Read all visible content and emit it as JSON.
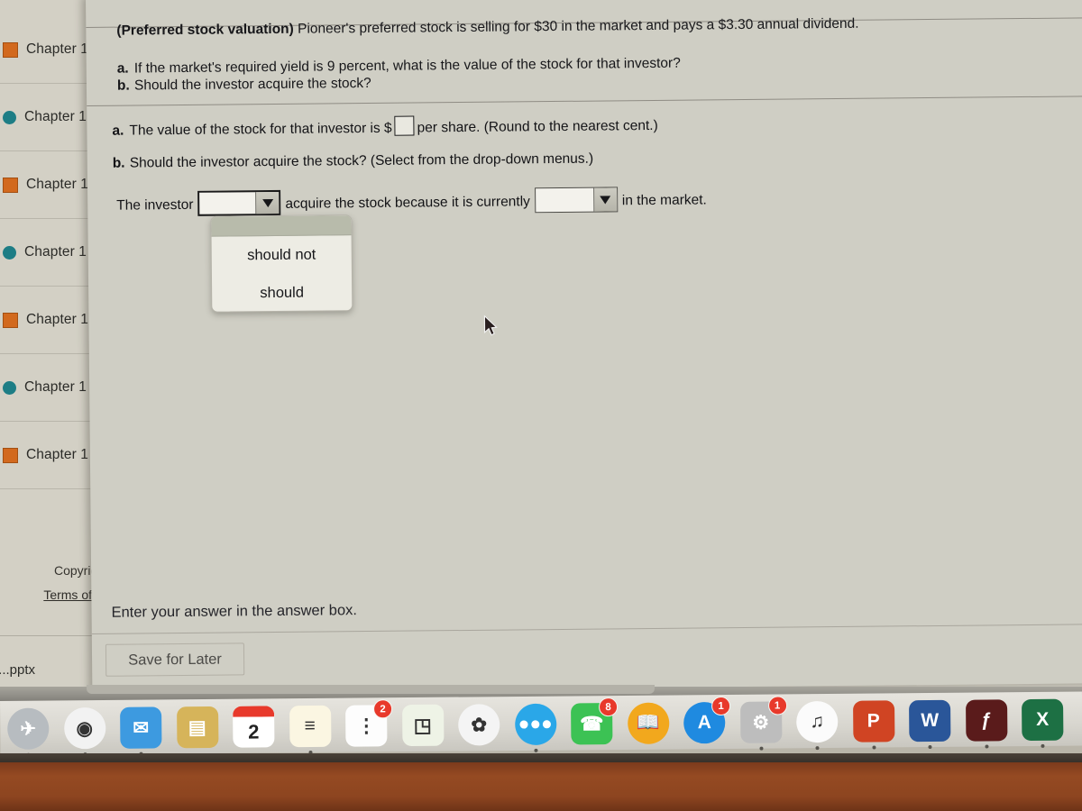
{
  "question": {
    "topic_label": "(Preferred stock valuation)",
    "stem": "Pioneer's preferred stock is selling for $30 in the market and pays a $3.30 annual dividend.",
    "parts": [
      {
        "letter": "a.",
        "text": "If the market's required yield is 9 percent, what is the value of the stock for that investor?"
      },
      {
        "letter": "b.",
        "text": "Should the investor acquire the stock?"
      }
    ]
  },
  "answer_area": {
    "part_a_letter": "a.",
    "part_a_pre": "The value of the stock for that investor is $",
    "part_a_value": "",
    "part_a_post": "per share.  (Round to the nearest cent.)",
    "part_b_letter": "b.",
    "part_b_text": "Should the investor acquire the stock?  (Select from the drop-down menus.)",
    "sentence_start": "The investor",
    "dropdown1_value": "",
    "sentence_middle": "acquire the stock because it is currently",
    "dropdown2_value": "",
    "sentence_end": "in the market."
  },
  "open_dropdown": {
    "name": "should-dropdown",
    "options": [
      "should not",
      "should"
    ]
  },
  "footer": {
    "hint": "Enter your answer in the answer box.",
    "save_label": "Save for Later"
  },
  "sidebar": {
    "chapters": [
      {
        "label": "Chapter 1",
        "marker": "square"
      },
      {
        "label": "Chapter 1",
        "marker": "circle"
      },
      {
        "label": "Chapter 1",
        "marker": "square"
      },
      {
        "label": "Chapter 1",
        "marker": "circle"
      },
      {
        "label": "Chapter 1",
        "marker": "square"
      },
      {
        "label": "Chapter 1",
        "marker": "circle"
      },
      {
        "label": "Chapter 1",
        "marker": "square"
      }
    ],
    "copyright": "Copyrigh",
    "terms_link": "Terms of U",
    "file_chip": "....pptx"
  },
  "dock": {
    "items": [
      {
        "name": "launchpad",
        "glyph": "✈",
        "bg": "#b7bcc0",
        "round": true,
        "badge": "",
        "running": true
      },
      {
        "name": "google-chrome",
        "glyph": "◉",
        "bg": "#f2f2f2",
        "round": true,
        "badge": "",
        "running": true
      },
      {
        "name": "mail",
        "glyph": "✉",
        "bg": "#3d9ae0",
        "round": false,
        "badge": "",
        "running": true
      },
      {
        "name": "finder-folder",
        "glyph": "▤",
        "bg": "#d6b45a",
        "round": false,
        "badge": "",
        "running": false
      },
      {
        "name": "calendar",
        "glyph": "2",
        "bg": "#ffffff",
        "round": false,
        "badge": "",
        "running": false
      },
      {
        "name": "notes",
        "glyph": "≡",
        "bg": "#fbf6e2",
        "round": false,
        "badge": "",
        "running": true
      },
      {
        "name": "reminders",
        "glyph": "⋮",
        "bg": "#fdfdfd",
        "round": false,
        "badge": "2",
        "running": false
      },
      {
        "name": "maps",
        "glyph": "◳",
        "bg": "#eef3e6",
        "round": false,
        "badge": "",
        "running": false
      },
      {
        "name": "photos",
        "glyph": "✿",
        "bg": "#f4f4f4",
        "round": true,
        "badge": "",
        "running": false
      },
      {
        "name": "messages",
        "glyph": "●●●",
        "bg": "#2aa7e8",
        "round": true,
        "badge": "",
        "running": true
      },
      {
        "name": "facetime",
        "glyph": "☎",
        "bg": "#3cc254",
        "round": false,
        "badge": "8",
        "running": false
      },
      {
        "name": "books",
        "glyph": "📖",
        "bg": "#f2a81d",
        "round": true,
        "badge": "",
        "running": false
      },
      {
        "name": "app-store",
        "glyph": "A",
        "bg": "#1f8ae0",
        "round": true,
        "badge": "1",
        "running": false
      },
      {
        "name": "system-preferences",
        "glyph": "⚙",
        "bg": "#bdbdbd",
        "round": false,
        "badge": "1",
        "running": true
      },
      {
        "name": "music",
        "glyph": "♫",
        "bg": "#fbfbfb",
        "round": true,
        "badge": "",
        "running": true
      },
      {
        "name": "powerpoint",
        "glyph": "P",
        "bg": "#d04423",
        "round": false,
        "badge": "",
        "running": true
      },
      {
        "name": "word",
        "glyph": "W",
        "bg": "#2a5699",
        "round": false,
        "badge": "",
        "running": true
      },
      {
        "name": "flash-player",
        "glyph": "ƒ",
        "bg": "#5a1b1b",
        "round": false,
        "badge": "",
        "running": true
      },
      {
        "name": "excel",
        "glyph": "X",
        "bg": "#1d7044",
        "round": false,
        "badge": "",
        "running": true
      }
    ]
  },
  "colors": {
    "accent_orange": "#d2691e",
    "accent_teal": "#1d7d85",
    "badge_red": "#e8392b",
    "page_bg": "#cfcec4"
  }
}
